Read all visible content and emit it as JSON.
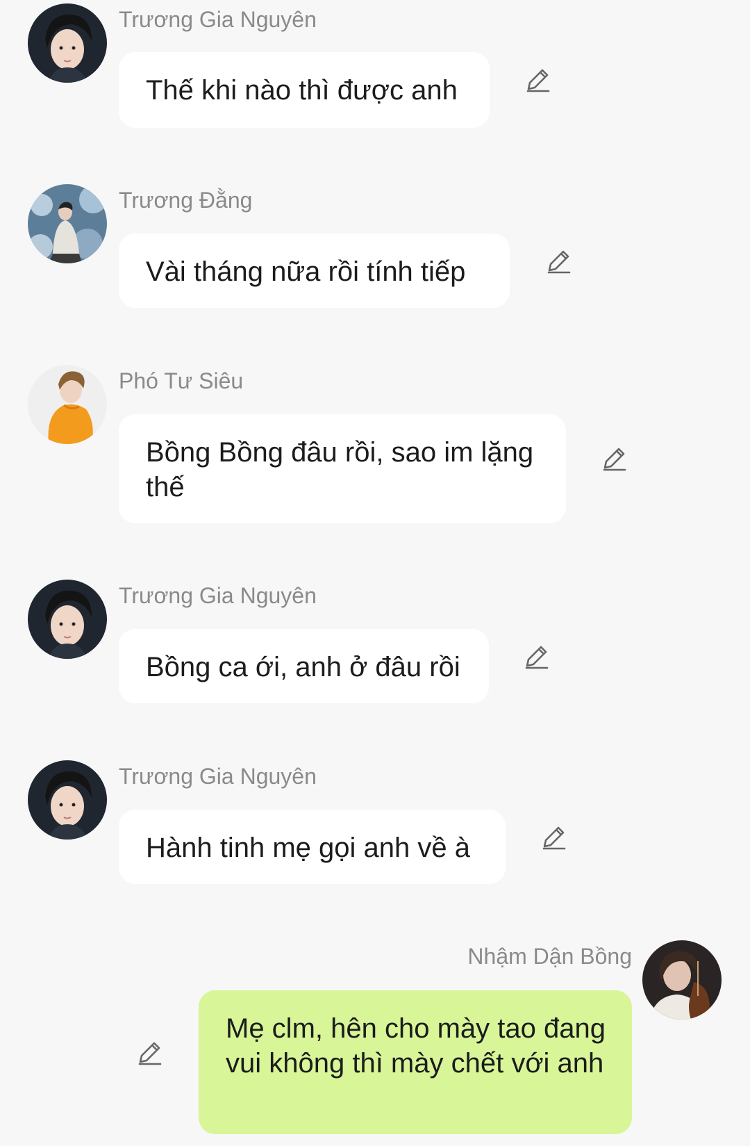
{
  "messages": [
    {
      "sender": "Trương Gia Nguyên",
      "text": "Thế khi nào thì được anh",
      "own": false
    },
    {
      "sender": "Trương Đằng",
      "text": "Vài tháng nữa rồi tính tiếp",
      "own": false
    },
    {
      "sender": "Phó Tư Siêu",
      "text": "Bồng Bồng đâu rồi, sao im lặng thế",
      "own": false
    },
    {
      "sender": "Trương Gia Nguyên",
      "text": "Bồng ca ới, anh ở đâu rồi",
      "own": false
    },
    {
      "sender": "Trương Gia Nguyên",
      "text": "Hành tinh mẹ gọi anh về à",
      "own": false
    },
    {
      "sender": "Nhậm Dận Bồng",
      "text": "Mẹ clm, hên cho mày tao đang vui không thì mày chết với anh",
      "own": true
    }
  ],
  "icons": {
    "edit": "pencil-edit-icon",
    "avatar": "user-photo"
  },
  "colors": {
    "background": "#f7f7f7",
    "incoming_bubble": "#ffffff",
    "outgoing_bubble": "#d8f598",
    "sender_name": "#8a8a8a",
    "message_text": "#1c1c1c"
  }
}
